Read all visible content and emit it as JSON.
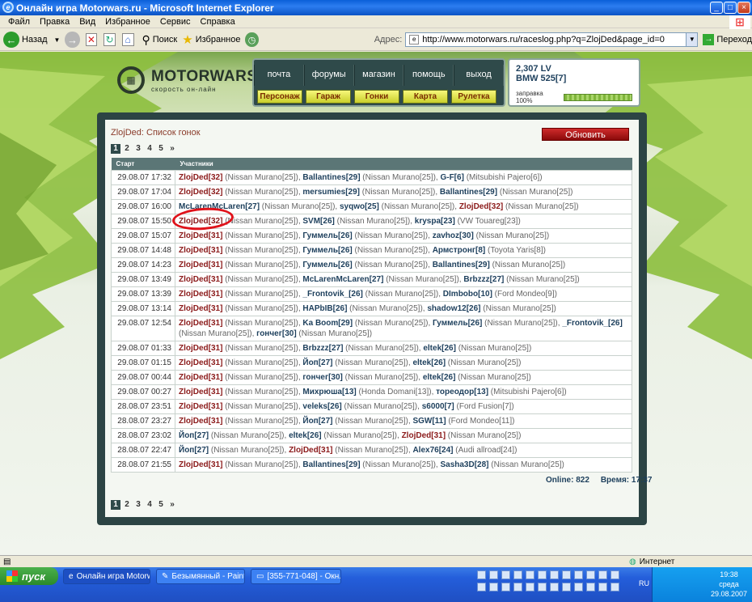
{
  "window": {
    "title": "Онлайн игра Motorwars.ru - Microsoft Internet Explorer"
  },
  "menu": [
    "Файл",
    "Правка",
    "Вид",
    "Избранное",
    "Сервис",
    "Справка"
  ],
  "toolbar": {
    "back": "Назад",
    "search": "Поиск",
    "favorites": "Избранное",
    "address_label": "Адрес:",
    "url": "http://www.motorwars.ru/raceslog.php?q=ZlojDed&page_id=0",
    "go": "Переход"
  },
  "site": {
    "logo": "MOTORWARS.RU",
    "tagline": "скорость он-лайн",
    "nav_top": [
      "почта",
      "форумы",
      "магазин",
      "помощь",
      "выход"
    ],
    "nav_bottom": [
      "Персонаж",
      "Гараж",
      "Гонки",
      "Карта",
      "Рулетка"
    ],
    "money": "2,307 LV",
    "car": "BMW 525[7]",
    "fuel_label": "заправка 100%",
    "fuel_level": 1.0
  },
  "panel": {
    "caption": "ZlojDed: Список гонок",
    "refresh": "Обновить",
    "pages": [
      "1",
      "2",
      "3",
      "4",
      "5",
      "»"
    ],
    "current_page": "1",
    "headers": [
      "Старт",
      "Участники"
    ]
  },
  "rows": [
    {
      "date": "29.08.07 17:32",
      "p": [
        [
          "ZlojDed[32]",
          "me",
          " (Nissan Murano[25]), "
        ],
        [
          "Ballantines[29]",
          "ot",
          " (Nissan Murano[25]), "
        ],
        [
          "G-F[6]",
          "ot",
          " (Mitsubishi Pajero[6])"
        ]
      ]
    },
    {
      "date": "29.08.07 17:04",
      "p": [
        [
          "ZlojDed[32]",
          "me",
          " (Nissan Murano[25]), "
        ],
        [
          "mersumies[29]",
          "ot",
          " (Nissan Murano[25]), "
        ],
        [
          "Ballantines[29]",
          "ot",
          " (Nissan Murano[25])"
        ]
      ]
    },
    {
      "date": "29.08.07 16:00",
      "p": [
        [
          "McLarenMcLaren[27]",
          "ot",
          " (Nissan Murano[25]), "
        ],
        [
          "syqwo[25]",
          "ot",
          " (Nissan Murano[25]), "
        ],
        [
          "ZlojDed[32]",
          "me",
          " (Nissan Murano[25])"
        ]
      ]
    },
    {
      "date": "29.08.07 15:50",
      "p": [
        [
          "ZlojDed[32]",
          "me",
          " (Nissan Murano[25]), "
        ],
        [
          "SVM[26]",
          "ot",
          " (Nissan Murano[25]), "
        ],
        [
          "kryspa[23]",
          "ot",
          " (VW Touareg[23])"
        ]
      ]
    },
    {
      "date": "29.08.07 15:07",
      "p": [
        [
          "ZlojDed[31]",
          "me",
          " (Nissan Murano[25]), "
        ],
        [
          "Гуммель[26]",
          "ot",
          " (Nissan Murano[25]), "
        ],
        [
          "zavhoz[30]",
          "ot",
          " (Nissan Murano[25])"
        ]
      ]
    },
    {
      "date": "29.08.07 14:48",
      "p": [
        [
          "ZlojDed[31]",
          "me",
          " (Nissan Murano[25]), "
        ],
        [
          "Гуммель[26]",
          "ot",
          " (Nissan Murano[25]), "
        ],
        [
          "Армстронг[8]",
          "ot",
          " (Toyota Yaris[8])"
        ]
      ]
    },
    {
      "date": "29.08.07 14:23",
      "p": [
        [
          "ZlojDed[31]",
          "me",
          " (Nissan Murano[25]), "
        ],
        [
          "Гуммель[26]",
          "ot",
          " (Nissan Murano[25]), "
        ],
        [
          "Ballantines[29]",
          "ot",
          " (Nissan Murano[25])"
        ]
      ]
    },
    {
      "date": "29.08.07 13:49",
      "p": [
        [
          "ZlojDed[31]",
          "me",
          " (Nissan Murano[25]), "
        ],
        [
          "McLarenMcLaren[27]",
          "ot",
          " (Nissan Murano[25]), "
        ],
        [
          "Brbzzz[27]",
          "ot",
          " (Nissan Murano[25])"
        ]
      ]
    },
    {
      "date": "29.08.07 13:39",
      "p": [
        [
          "ZlojDed[31]",
          "me",
          " (Nissan Murano[25]), "
        ],
        [
          "_Frontovik_[26]",
          "ot",
          " (Nissan Murano[25]), "
        ],
        [
          "DImbobo[10]",
          "ot",
          " (Ford Mondeo[9])"
        ]
      ]
    },
    {
      "date": "29.08.07 13:14",
      "p": [
        [
          "ZlojDed[31]",
          "me",
          " (Nissan Murano[25]), "
        ],
        [
          "HAPbIB[26]",
          "ot",
          " (Nissan Murano[25]), "
        ],
        [
          "shadow12[26]",
          "ot",
          " (Nissan Murano[25])"
        ]
      ]
    },
    {
      "date": "29.08.07 12:54",
      "p": [
        [
          "ZlojDed[31]",
          "me",
          " (Nissan Murano[25]), "
        ],
        [
          "Ka Boom[29]",
          "ot",
          " (Nissan Murano[25]), "
        ],
        [
          "Гуммель[26]",
          "ot",
          " (Nissan Murano[25]), "
        ],
        [
          "_Frontovik_[26]",
          "ot",
          " (Nissan Murano[25]), "
        ],
        [
          "гончег[30]",
          "ot",
          " (Nissan Murano[25])"
        ]
      ]
    },
    {
      "date": "29.08.07 01:33",
      "p": [
        [
          "ZlojDed[31]",
          "me",
          " (Nissan Murano[25]), "
        ],
        [
          "Brbzzz[27]",
          "ot",
          " (Nissan Murano[25]), "
        ],
        [
          "eltek[26]",
          "ot",
          " (Nissan Murano[25])"
        ]
      ]
    },
    {
      "date": "29.08.07 01:15",
      "p": [
        [
          "ZlojDed[31]",
          "me",
          " (Nissan Murano[25]), "
        ],
        [
          "Йоп[27]",
          "ot",
          " (Nissan Murano[25]), "
        ],
        [
          "eltek[26]",
          "ot",
          " (Nissan Murano[25])"
        ]
      ]
    },
    {
      "date": "29.08.07 00:44",
      "p": [
        [
          "ZlojDed[31]",
          "me",
          " (Nissan Murano[25]), "
        ],
        [
          "гончег[30]",
          "ot",
          " (Nissan Murano[25]), "
        ],
        [
          "eltek[26]",
          "ot",
          " (Nissan Murano[25])"
        ]
      ]
    },
    {
      "date": "29.08.07 00:27",
      "p": [
        [
          "ZlojDed[31]",
          "me",
          " (Nissan Murano[25]), "
        ],
        [
          "Михрюша[13]",
          "ot",
          " (Honda Domani[13]), "
        ],
        [
          "тореодор[13]",
          "ot",
          " (Mitsubishi Pajero[6])"
        ]
      ]
    },
    {
      "date": "28.08.07 23:51",
      "p": [
        [
          "ZlojDed[31]",
          "me",
          " (Nissan Murano[25]), "
        ],
        [
          "veleks[26]",
          "ot",
          " (Nissan Murano[25]), "
        ],
        [
          "s6000[7]",
          "ot",
          " (Ford Fusion[7])"
        ]
      ]
    },
    {
      "date": "28.08.07 23:27",
      "p": [
        [
          "ZlojDed[31]",
          "me",
          " (Nissan Murano[25]), "
        ],
        [
          "Йоп[27]",
          "ot",
          " (Nissan Murano[25]), "
        ],
        [
          "SGW[11]",
          "ot",
          " (Ford Mondeo[11])"
        ]
      ]
    },
    {
      "date": "28.08.07 23:02",
      "p": [
        [
          "Йоп[27]",
          "ot",
          " (Nissan Murano[25]), "
        ],
        [
          "eltek[26]",
          "ot",
          " (Nissan Murano[25]), "
        ],
        [
          "ZlojDed[31]",
          "me",
          " (Nissan Murano[25])"
        ]
      ]
    },
    {
      "date": "28.08.07 22:47",
      "p": [
        [
          "Йоп[27]",
          "ot",
          " (Nissan Murano[25]), "
        ],
        [
          "ZlojDed[31]",
          "me",
          " (Nissan Murano[25]), "
        ],
        [
          "Alex76[24]",
          "ot",
          " (Audi allroad[24])"
        ]
      ]
    },
    {
      "date": "28.08.07 21:55",
      "p": [
        [
          "ZlojDed[31]",
          "me",
          " (Nissan Murano[25]), "
        ],
        [
          "Ballantines[29]",
          "ot",
          " (Nissan Murano[25]), "
        ],
        [
          "Sasha3D[28]",
          "ot",
          " (Nissan Murano[25])"
        ]
      ]
    }
  ],
  "footer": {
    "online": "Online: 822",
    "time": "Время: 17:37"
  },
  "status": {
    "zone": "Интернет"
  },
  "taskbar": {
    "start": "пуск",
    "tasks": [
      "Онлайн игра Motorw...",
      "Безымянный - Paint",
      "[355-771-048] - Окн..."
    ],
    "lang": "RU",
    "clock": "19:38",
    "day": "среда",
    "date": "29.08.2007"
  }
}
